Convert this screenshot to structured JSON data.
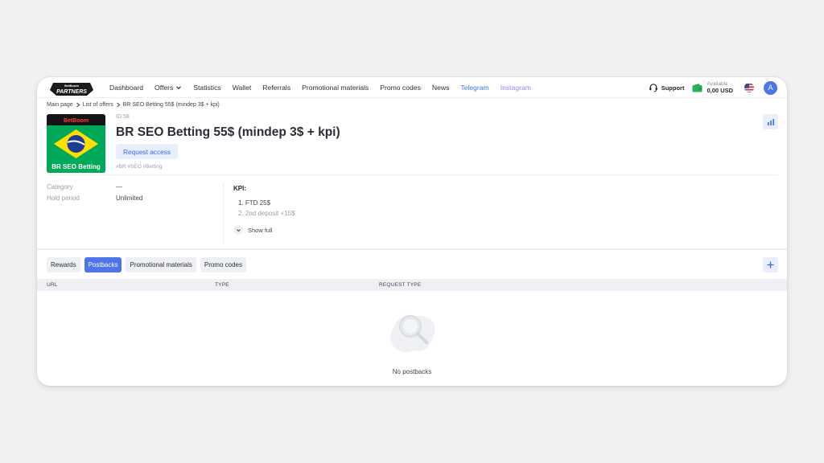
{
  "logo": {
    "top_text": "BetBoom",
    "main_text": "PARTNERS"
  },
  "nav": {
    "links": [
      "Dashboard",
      "Offers",
      "Statistics",
      "Wallet",
      "Referrals",
      "Promotional materials",
      "Promo codes",
      "News",
      "Telegram",
      "Instagram"
    ],
    "support_label": "Support",
    "wallet_label": "Available",
    "wallet_amount": "0,00 USD",
    "avatar_letter": "A"
  },
  "breadcrumb": [
    "Main page",
    "List of offers",
    "BR SEO Betting 55$ (mindep 3$ + kpi)"
  ],
  "offer": {
    "image_brand": "BetBoom",
    "image_caption": "BR SEO Betting",
    "id_label": "ID 58",
    "title": "BR SEO Betting 55$ (mindep 3$ + kpi)",
    "request_button": "Request access",
    "tags": "#BR #SEO #Betting"
  },
  "info": {
    "category_label": "Category",
    "category_value": "—",
    "hold_label": "Hold period",
    "hold_value": "Unlimited"
  },
  "kpi": {
    "title": "KPI:",
    "items": [
      "1. FTD 25$",
      "2. 2nd deposit +15$"
    ],
    "show_full": "Show full"
  },
  "tabs": [
    "Rewards",
    "Postbacks",
    "Promotional materials",
    "Promo codes"
  ],
  "active_tab": "Postbacks",
  "table": {
    "columns": [
      "URL",
      "TYPE",
      "REQUEST TYPE"
    ]
  },
  "empty_text": "No postbacks",
  "colors": {
    "accent": "#4e73ed",
    "link_blue": "#3d74f0",
    "link_purple": "#8c8cf0",
    "wallet_green": "#27b35a"
  }
}
